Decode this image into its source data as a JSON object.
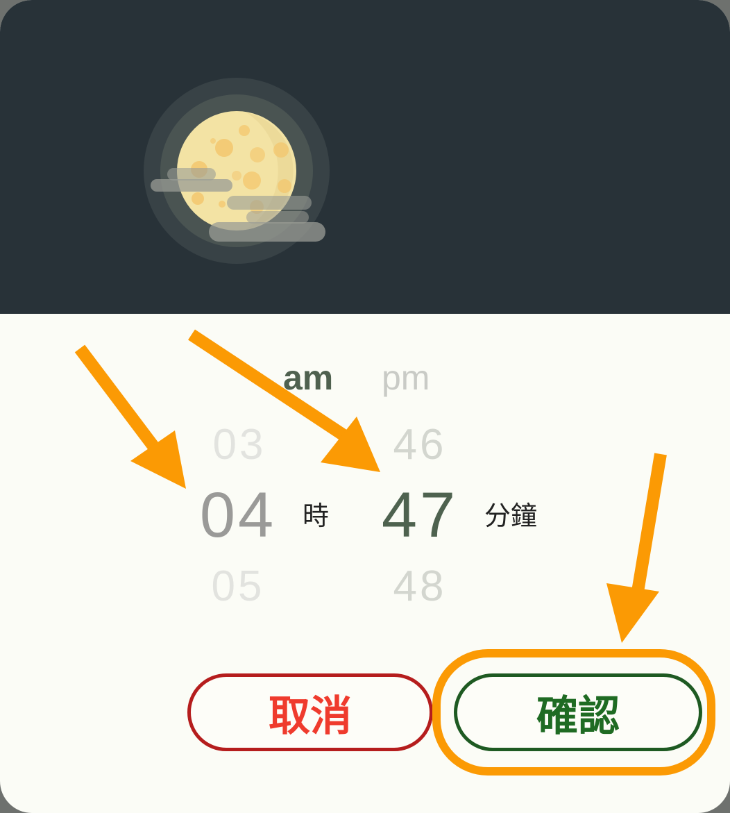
{
  "header": {
    "illustration": "moon-icon",
    "illustration_colors": {
      "background": "#283238",
      "moon": "#f3e3a4",
      "craters": "#f3c46a",
      "clouds": "#9a9c96"
    }
  },
  "picker": {
    "ampm": {
      "am_label": "am",
      "pm_label": "pm",
      "selected": "am"
    },
    "hour": {
      "previous": "03",
      "selected": "04",
      "next": "05",
      "unit": "時"
    },
    "minute": {
      "previous": "46",
      "selected": "47",
      "next": "48",
      "unit": "分鐘"
    }
  },
  "buttons": {
    "cancel_label": "取消",
    "confirm_label": "確認",
    "cancel_color": "#ef3b2d",
    "confirm_color": "#1f6b23"
  },
  "annotations": {
    "arrow_color": "#fb9a04",
    "highlight_color": "#fb9a04"
  }
}
